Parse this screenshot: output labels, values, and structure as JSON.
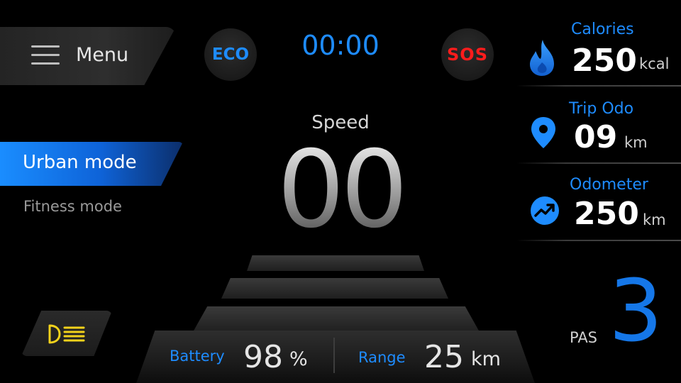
{
  "menu": {
    "label": "Menu",
    "icon": "hamburger-icon"
  },
  "header": {
    "eco_label": "ECO",
    "timer": "00:00",
    "sos_label": "SOS"
  },
  "modes": [
    {
      "label": "Urban mode",
      "active": true
    },
    {
      "label": "Fitness mode",
      "active": false
    }
  ],
  "speed": {
    "label": "Speed",
    "value": "00"
  },
  "stats": {
    "calories": {
      "label": "Calories",
      "value": "250",
      "unit": "kcal",
      "icon": "flame-icon"
    },
    "trip_odo": {
      "label": "Trip Odo",
      "value": "09",
      "unit": "km",
      "icon": "location-pin-icon"
    },
    "odometer": {
      "label": "Odometer",
      "value": "250",
      "unit": "km",
      "icon": "trend-up-icon"
    }
  },
  "bottom": {
    "battery_label": "Battery",
    "battery_value": "98",
    "battery_unit": "%",
    "range_label": "Range",
    "range_value": "25",
    "range_unit": "km"
  },
  "pas": {
    "label": "PAS",
    "value": "3"
  },
  "headlight": {
    "icon": "headlight-icon"
  },
  "colors": {
    "accent": "#1e8cff",
    "sos": "#ff1c1c",
    "headlight": "#f2d21b",
    "background": "#000000"
  }
}
